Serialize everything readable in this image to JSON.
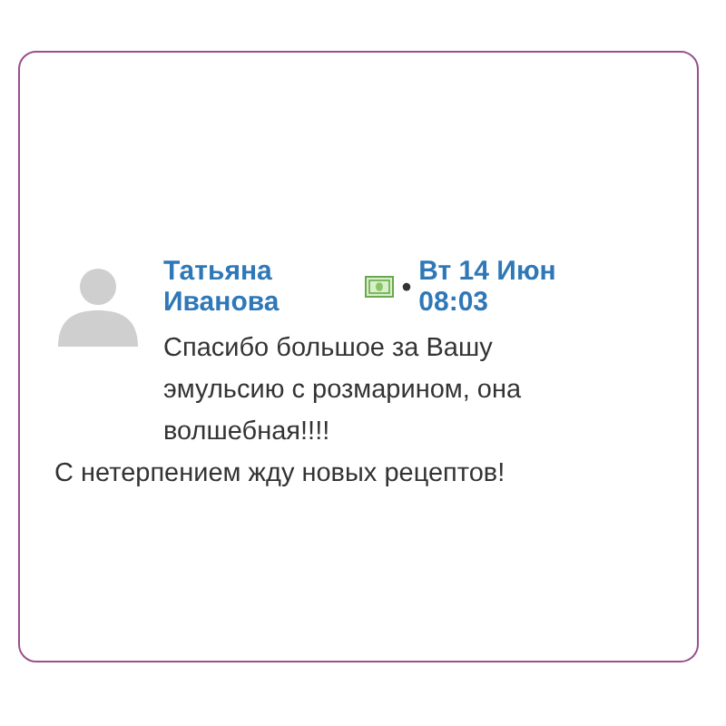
{
  "comment": {
    "author": "Татьяна Иванова",
    "separator": "•",
    "date": "Вт 14 Июн 08:03",
    "paragraphs": [
      "Спасибо большое за Вашу эмульсию с розмарином, она волшебная!!!!",
      "С нетерпением жду новых рецептов!"
    ]
  }
}
